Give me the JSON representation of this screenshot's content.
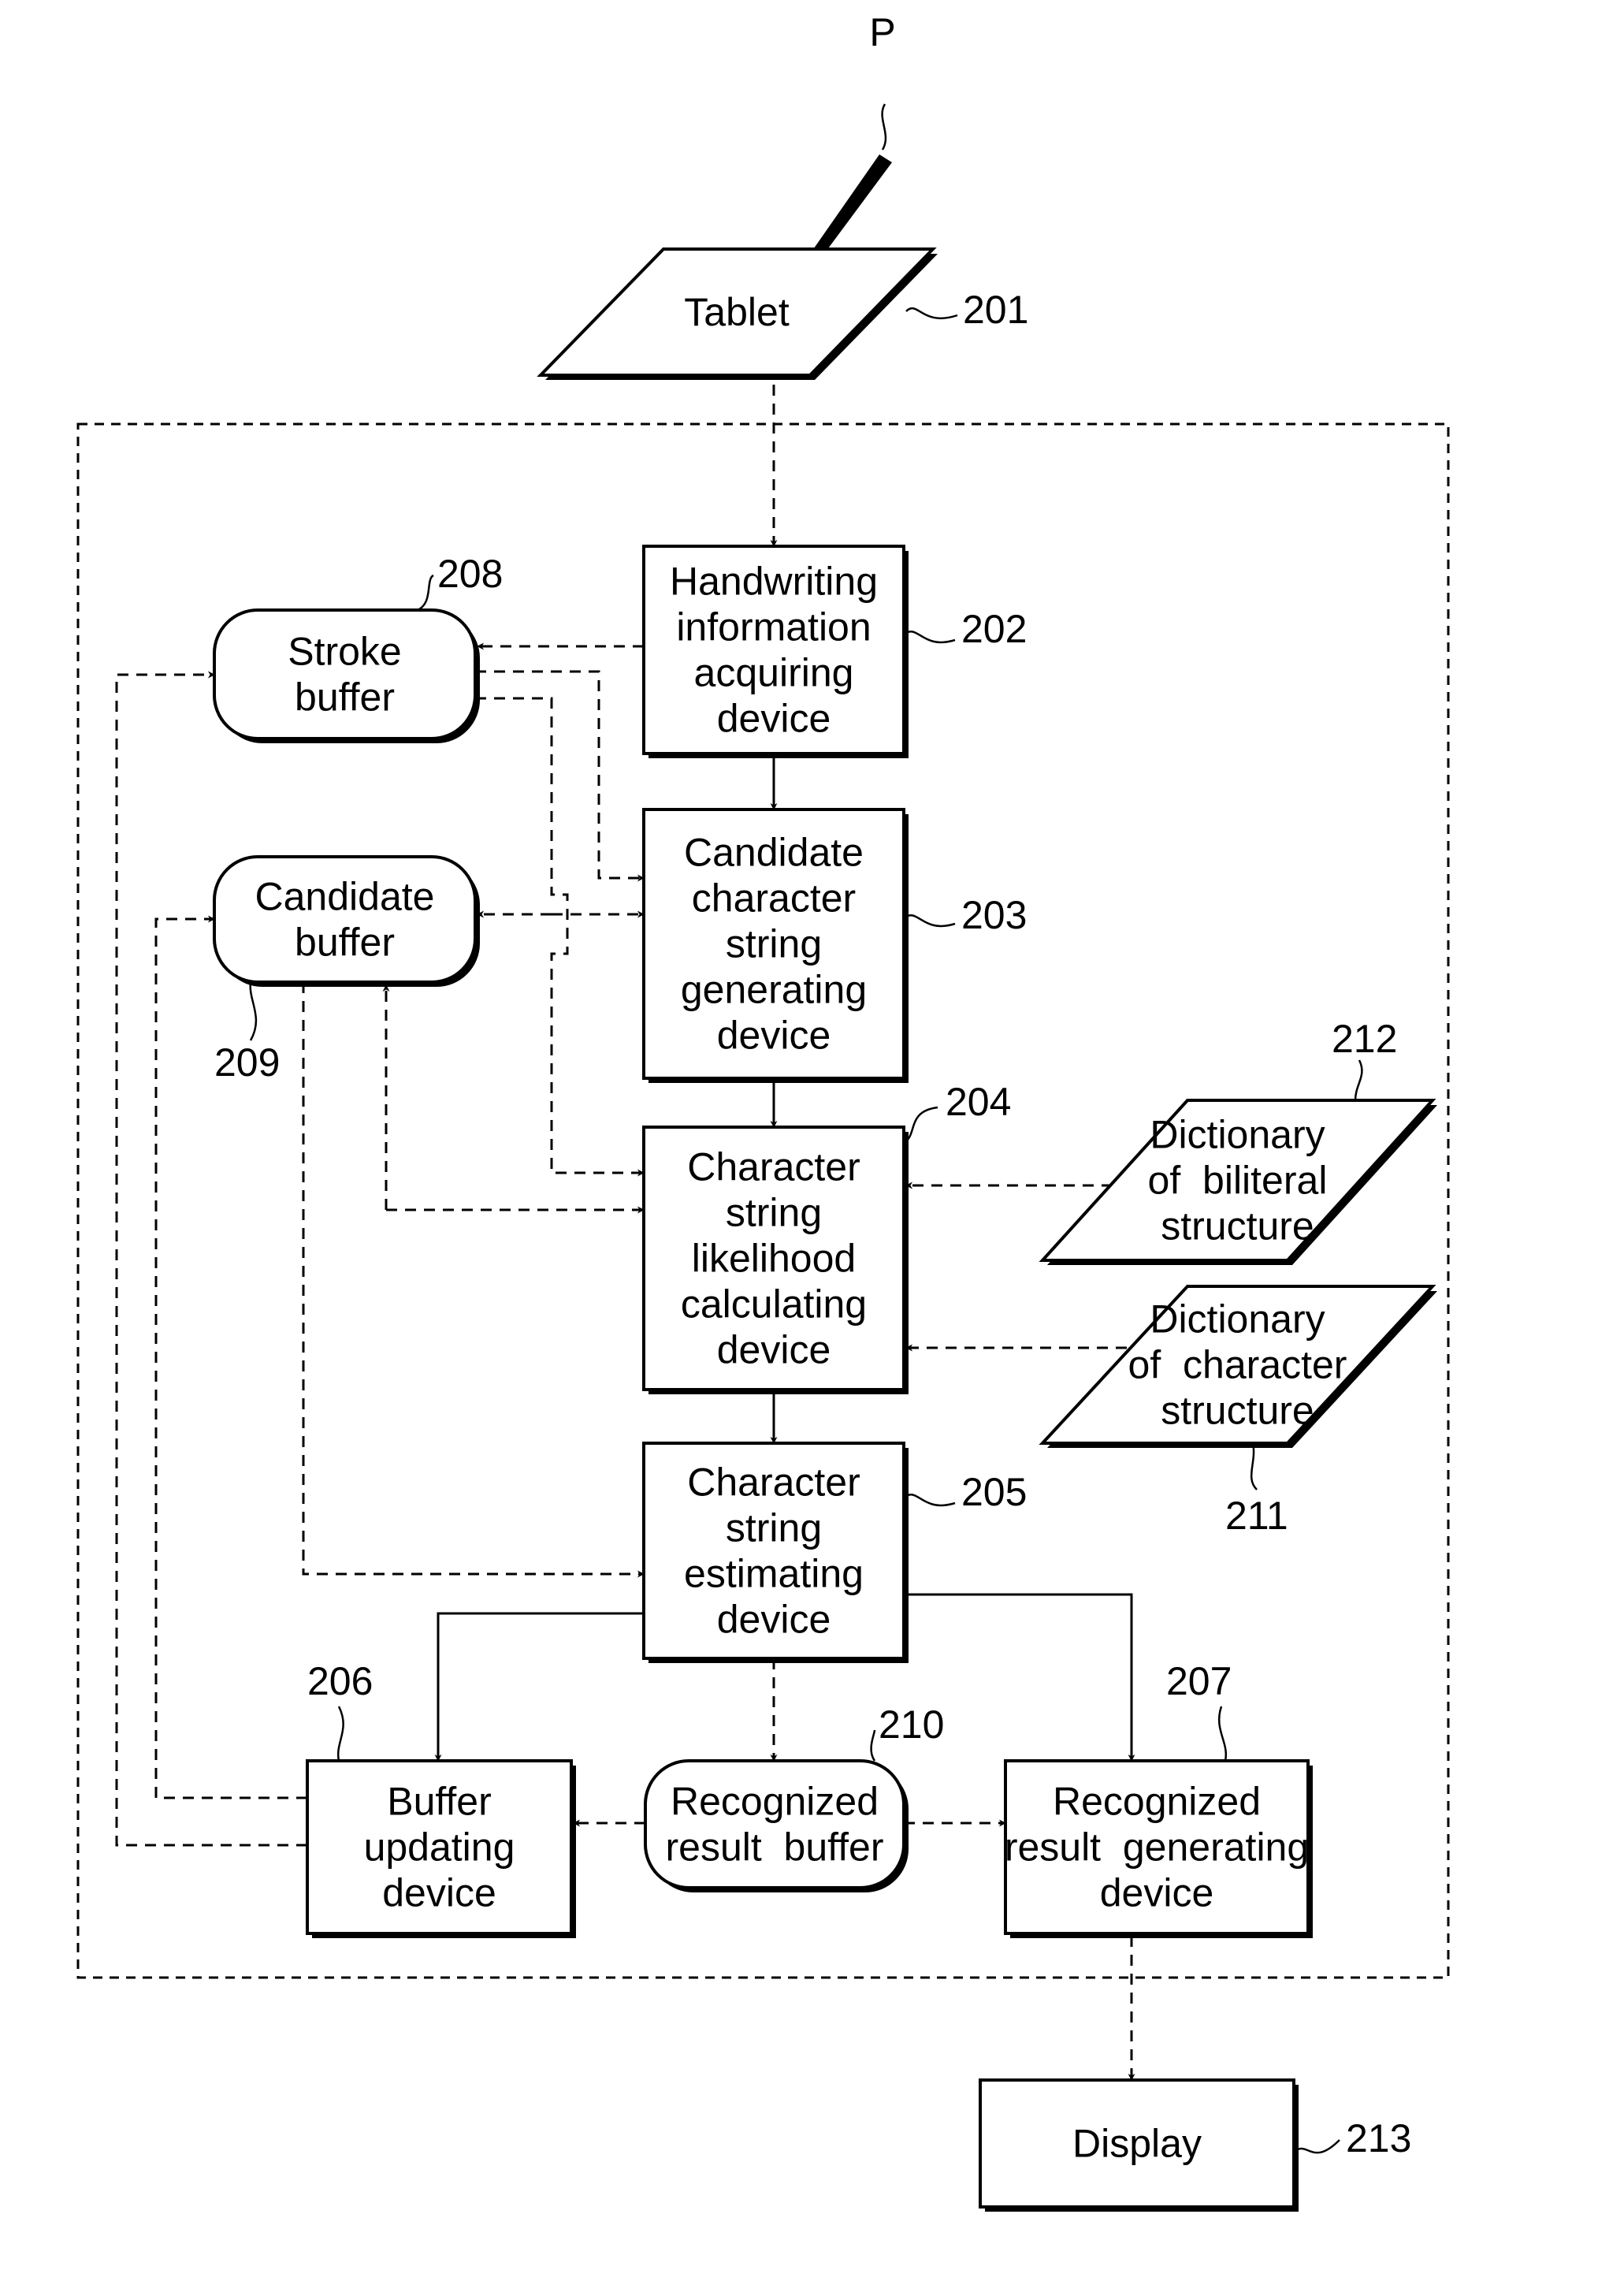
{
  "figure": {
    "pen": {
      "label": "P"
    },
    "nodes": {
      "tablet": {
        "lines": [
          "Tablet"
        ],
        "ref": "201"
      },
      "handwriting": {
        "lines": [
          "Handwriting",
          "information",
          "acquiring",
          "device"
        ],
        "ref": "202"
      },
      "candidate_gen": {
        "lines": [
          "Candidate",
          "character",
          "string",
          "generating",
          "device"
        ],
        "ref": "203"
      },
      "likelihood": {
        "lines": [
          "Character",
          "string",
          "likelihood",
          "calculating",
          "device"
        ],
        "ref": "204"
      },
      "estimating": {
        "lines": [
          "Character",
          "string",
          "estimating",
          "device"
        ],
        "ref": "205"
      },
      "buffer_updating": {
        "lines": [
          "Buffer",
          "updating",
          "device"
        ],
        "ref": "206"
      },
      "result_generating": {
        "lines": [
          "Recognized",
          "result  generating",
          "device"
        ],
        "ref": "207"
      },
      "stroke_buffer": {
        "lines": [
          "Stroke",
          "buffer"
        ],
        "ref": "208"
      },
      "candidate_buffer": {
        "lines": [
          "Candidate",
          "buffer"
        ],
        "ref": "209"
      },
      "result_buffer": {
        "lines": [
          "Recognized",
          "result  buffer"
        ],
        "ref": "210"
      },
      "dict_char": {
        "lines": [
          "Dictionary",
          "of  character",
          "structure"
        ],
        "ref": "211"
      },
      "dict_bilit": {
        "lines": [
          "Dictionary",
          "of  biliteral",
          "structure"
        ],
        "ref": "212"
      },
      "display": {
        "lines": [
          "Display"
        ],
        "ref": "213"
      }
    }
  }
}
